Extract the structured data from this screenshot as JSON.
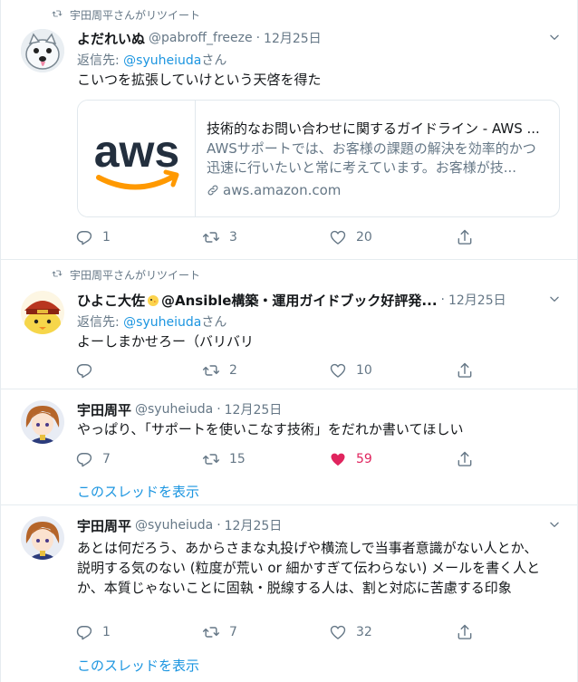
{
  "tweets": [
    {
      "retweeted_by": "宇田周平さんがリツイート",
      "name": "よだれいぬ",
      "handle": "@pabroff_freeze",
      "separator": "·",
      "time": "12月25日",
      "reply_prefix": "返信先: ",
      "reply_to": "@syuheiuda",
      "reply_suffix": "さん",
      "text": "こいつを拡張していけという天啓を得た",
      "card": {
        "logo_text": "aws",
        "title": "技術的なお問い合わせに関するガイドライン - AWS ...",
        "description": "AWSサポートでは、お客様の課題の解決を効率的かつ迅速に行いたいと常に考えています。お客様が技...",
        "domain": "aws.amazon.com"
      },
      "replies": "1",
      "retweets": "3",
      "likes": "20"
    },
    {
      "retweeted_by": "宇田周平さんがリツイート",
      "name_prefix": "ひよこ大佐",
      "name_suffix": "@Ansible構築・運用ガイドブック好評発...",
      "separator": "·",
      "time": "12月25日",
      "reply_prefix": "返信先: ",
      "reply_to": "@syuheiuda",
      "reply_suffix": "さん",
      "text": "よーしまかせろー（バリバリ",
      "replies": "",
      "retweets": "2",
      "likes": "10"
    },
    {
      "name": "宇田周平",
      "handle": "@syuheiuda",
      "separator": "·",
      "time": "12月25日",
      "text": "やっぱり、「サポートを使いこなす技術」をだれか書いてほしい",
      "replies": "7",
      "retweets": "15",
      "likes": "59",
      "liked": true,
      "thread_link": "このスレッドを表示"
    },
    {
      "name": "宇田周平",
      "handle": "@syuheiuda",
      "separator": "·",
      "time": "12月25日",
      "text": "あとは何だろう、あからさまな丸投げや横流しで当事者意識がない人とか、説明する気のない (粒度が荒い or 細かすぎて伝わらない) メールを書く人とか、本質じゃないことに固執・脱線する人は、割と対応に苦慮する印象",
      "replies": "1",
      "retweets": "7",
      "likes": "32",
      "thread_link": "このスレッドを表示"
    }
  ],
  "colors": {
    "link": "#1b95e0",
    "secondary": "#657786",
    "like_active": "#e0245e",
    "border": "#e6ecf0"
  },
  "icons": [
    "retweet-icon",
    "chevron-down-icon",
    "reply-icon",
    "like-icon",
    "share-icon",
    "link-icon"
  ]
}
